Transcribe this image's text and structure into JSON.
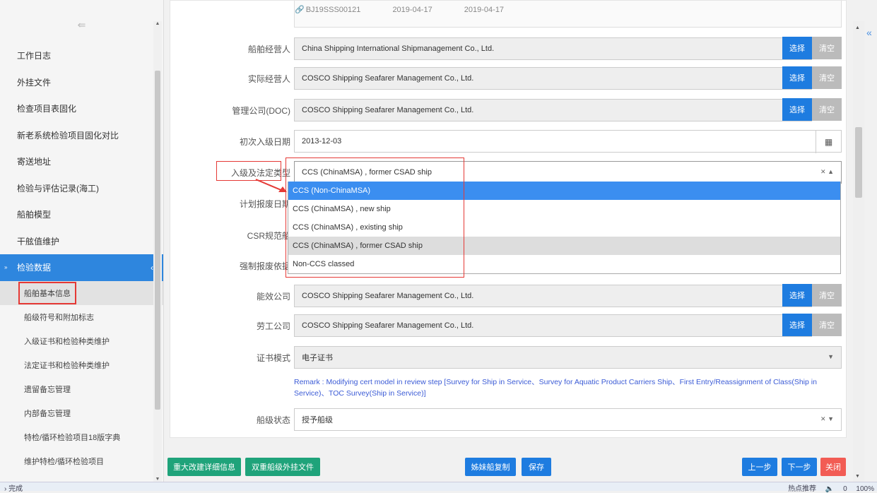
{
  "sidebar": {
    "items": [
      {
        "label": "工作日志"
      },
      {
        "label": "外挂文件"
      },
      {
        "label": "检查项目表固化"
      },
      {
        "label": "新老系统检验项目固化对比"
      },
      {
        "label": "寄送地址"
      },
      {
        "label": "检验与评估记录(海工)"
      },
      {
        "label": "船舶模型"
      },
      {
        "label": "干舷值维护"
      }
    ],
    "active_group": "检验数据",
    "sub_items": [
      {
        "label": "船舶基本信息"
      },
      {
        "label": "船级符号和附加标志"
      },
      {
        "label": "入级证书和检验种类维护"
      },
      {
        "label": "法定证书和检验种类维护"
      },
      {
        "label": "遗留备忘管理"
      },
      {
        "label": "内部备忘管理"
      },
      {
        "label": "特检/循环检验项目18版字典"
      },
      {
        "label": "维护特检/循环检验项目"
      }
    ]
  },
  "top_strip": {
    "id": "BJ19SSS00121",
    "date1": "2019-04-17",
    "date2": "2019-04-17"
  },
  "form": {
    "operator_label": "船舶经营人",
    "operator_value": "China Shipping International Shipmanagement Co., Ltd.",
    "actual_operator_label": "实际经营人",
    "actual_operator_value": "COSCO Shipping Seafarer Management Co., Ltd.",
    "doc_label": "管理公司(DOC)",
    "doc_value": "COSCO Shipping Seafarer Management Co., Ltd.",
    "first_class_date_label": "初次入级日期",
    "first_class_date_value": "2013-12-03",
    "class_type_label": "入级及法定类型",
    "class_type_value": "CCS (ChinaMSA) , former CSAD ship",
    "scrap_date_label": "计划报废日期",
    "csr_label": "CSR规范船",
    "forced_scrap_label": "强制报废依据",
    "energy_company_label": "能效公司",
    "energy_company_value": "COSCO Shipping Seafarer Management Co., Ltd.",
    "labor_company_label": "劳工公司",
    "labor_company_value": "COSCO Shipping Seafarer Management Co., Ltd.",
    "cert_mode_label": "证书模式",
    "cert_mode_value": "电子证书",
    "remark": "Remark : Modifying cert model in review step [Survey for Ship in Service、Survey for Aquatic Product Carriers Ship、First Entry/Reassignment of Class(Ship in Service)、TOC Survey(Ship in Service)]",
    "class_status_label": "船级状态",
    "class_status_value": "授予船级",
    "select_label": "选择",
    "clear_label": "清空"
  },
  "dropdown": {
    "options": [
      "CCS (Non-ChinaMSA)",
      "CCS (ChinaMSA) , new ship",
      "CCS (ChinaMSA) , existing ship",
      "CCS (ChinaMSA) , former CSAD ship",
      "Non-CCS classed"
    ]
  },
  "toolbar": {
    "major_mod": "重大改建详细信息",
    "dual_class": "双重船级外挂文件",
    "sister_copy": "姊妹船复制",
    "save": "保存",
    "prev": "上一步",
    "next": "下一步",
    "close": "关闭"
  },
  "statusbar": {
    "left": "完成",
    "hot": "热点推荐",
    "count": "0",
    "zoom": "100%"
  },
  "colors": {
    "accent": "#1e7ce0",
    "green": "#1fa37a",
    "red": "#f25c54",
    "annotation": "#e53935"
  }
}
